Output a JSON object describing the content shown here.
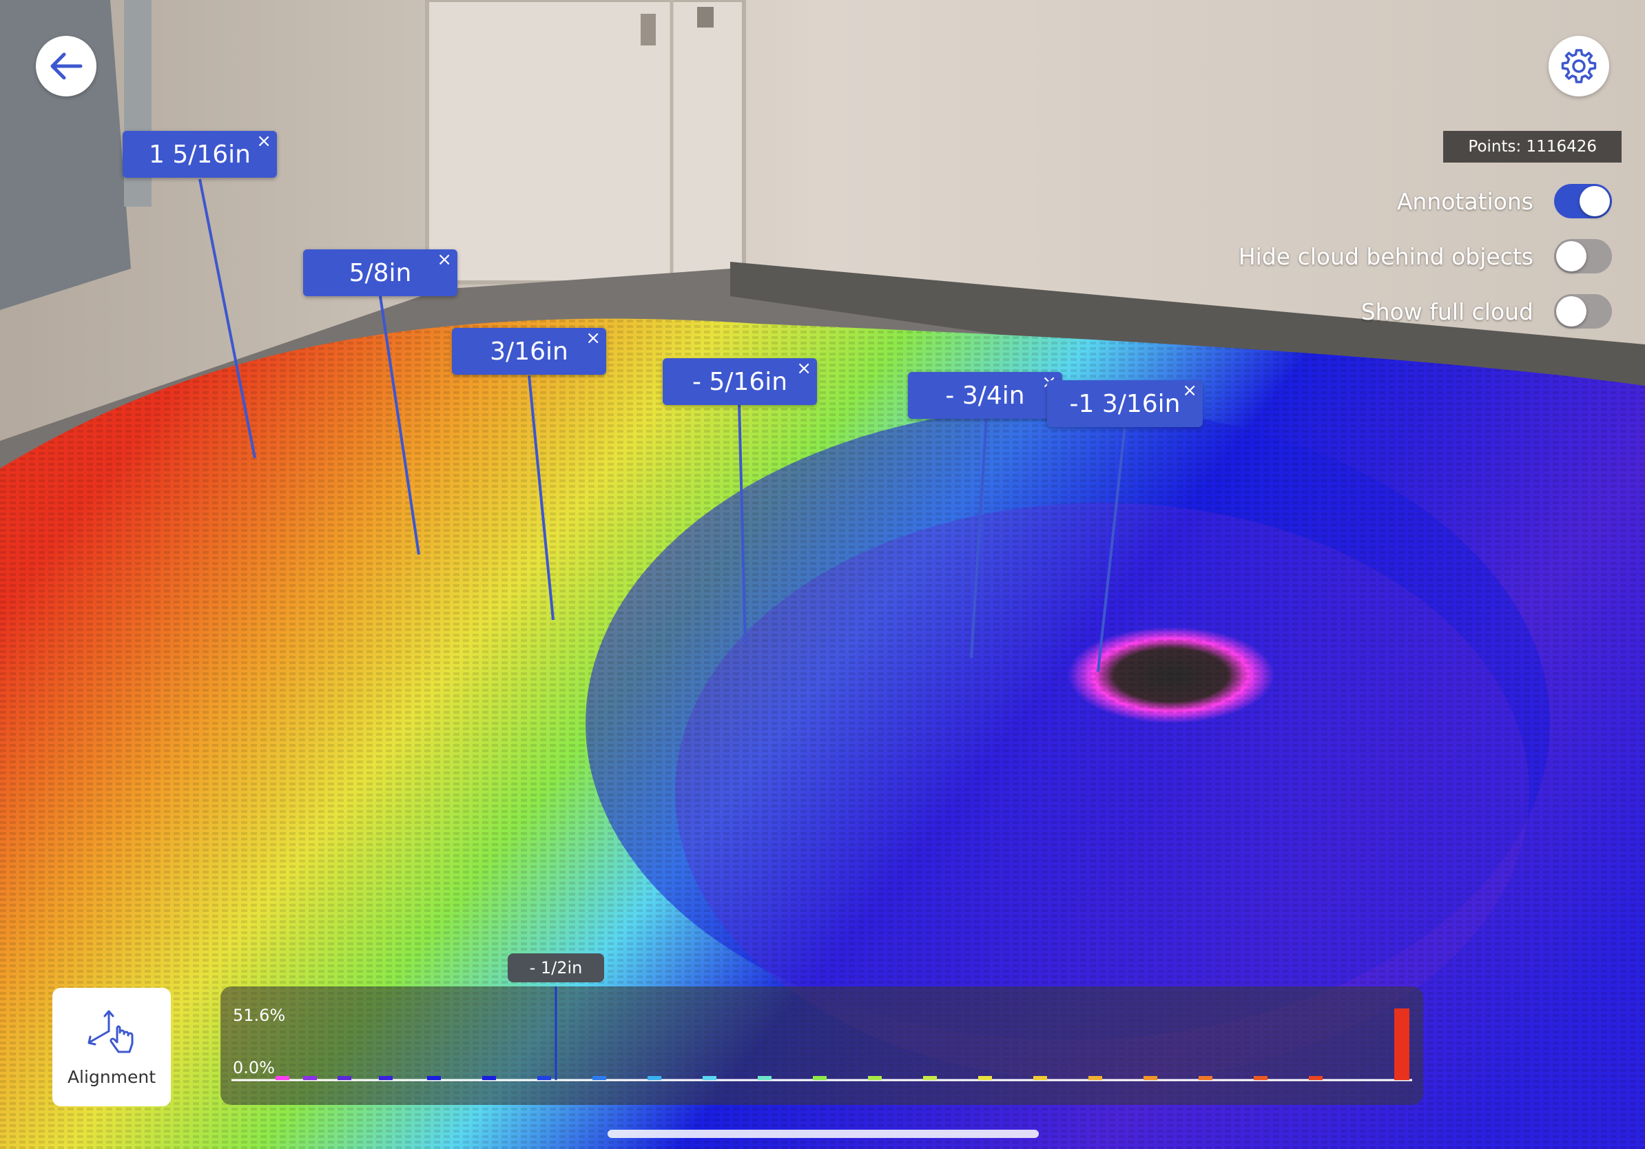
{
  "points_label": "Points: 1116426",
  "toggles": [
    {
      "label": "Annotations",
      "on": true
    },
    {
      "label": "Hide cloud behind objects",
      "on": false
    },
    {
      "label": "Show full cloud",
      "on": false
    }
  ],
  "annotations": [
    {
      "label": "1 5/16in",
      "close": "×"
    },
    {
      "label": "5/8in",
      "close": "×"
    },
    {
      "label": "3/16in",
      "close": "×"
    },
    {
      "label": "- 5/16in",
      "close": "×"
    },
    {
      "label": "- 3/4in",
      "close": "×"
    },
    {
      "label": "-1 3/16in",
      "close": "×"
    }
  ],
  "alignment": {
    "label": "Alignment",
    "icon": "alignment-gesture-icon"
  },
  "histogram": {
    "y_max_label": "51.6%",
    "y_min_label": "0.0%",
    "marker_label": "- 1/2in"
  },
  "icons": {
    "back": "arrow-left-icon",
    "settings": "gear-icon"
  },
  "colors": {
    "accent": "#3d57cf",
    "heatmap_high": "#e8321e",
    "heatmap_mid": "#8ee84a",
    "heatmap_low": "#1a1ee0",
    "heatmap_lowest": "#ff40f0"
  }
}
